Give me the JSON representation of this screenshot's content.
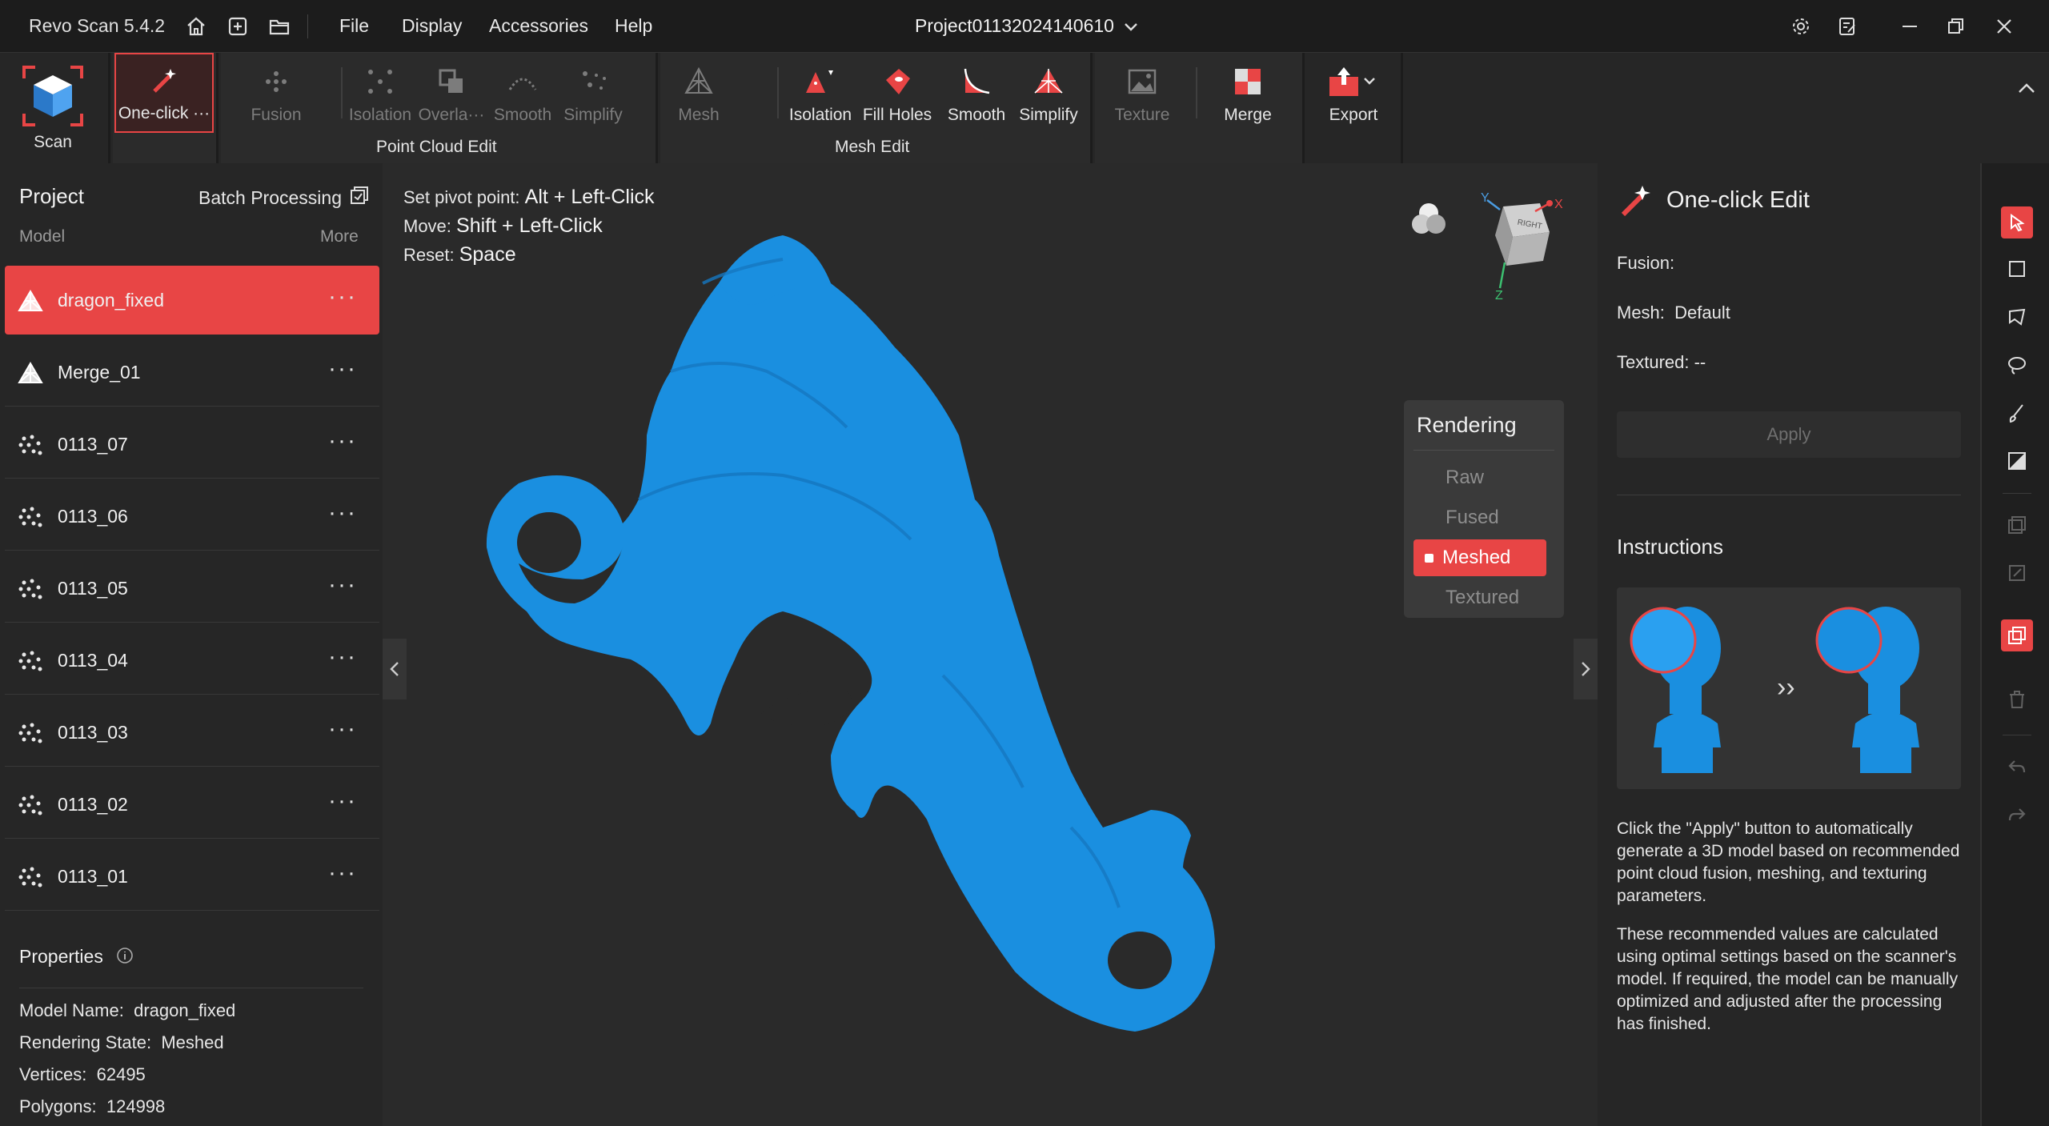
{
  "app": {
    "name": "Revo Scan 5.4.2",
    "project": "Project01132024140610"
  },
  "menu": [
    "File",
    "Display",
    "Accessories",
    "Help"
  ],
  "toolbar": {
    "scan": "Scan",
    "one_click": "One-click ···",
    "fusion": "Fusion",
    "point_cloud": {
      "isolation": "Isolation",
      "overlap": "Overla···",
      "smooth": "Smooth",
      "simplify": "Simplify",
      "label": "Point Cloud Edit"
    },
    "mesh_edit": {
      "mesh": "Mesh",
      "isolation": "Isolation",
      "fill_holes": "Fill Holes",
      "smooth": "Smooth",
      "simplify": "Simplify",
      "label": "Mesh Edit"
    },
    "texture": "Texture",
    "merge": "Merge",
    "export": "Export"
  },
  "left_panel": {
    "title": "Project",
    "batch": "Batch Processing",
    "model_header": "Model",
    "more": "More",
    "models": [
      {
        "name": "dragon_fixed",
        "type": "mesh",
        "selected": true
      },
      {
        "name": "Merge_01",
        "type": "mesh"
      },
      {
        "name": "0113_07",
        "type": "points"
      },
      {
        "name": "0113_06",
        "type": "points"
      },
      {
        "name": "0113_05",
        "type": "points"
      },
      {
        "name": "0113_04",
        "type": "points"
      },
      {
        "name": "0113_03",
        "type": "points"
      },
      {
        "name": "0113_02",
        "type": "points"
      },
      {
        "name": "0113_01",
        "type": "points"
      }
    ],
    "dots": "···",
    "properties_title": "Properties",
    "properties": {
      "model_name_label": "Model Name:",
      "model_name": "dragon_fixed",
      "rendering_label": "Rendering State:",
      "rendering": "Meshed",
      "vertices_label": "Vertices:",
      "vertices": "62495",
      "polygons_label": "Polygons:",
      "polygons": "124998"
    }
  },
  "viewport": {
    "hints": [
      {
        "label": "Set pivot point:",
        "keys": "Alt + Left-Click"
      },
      {
        "label": "Move:",
        "keys": "Shift + Left-Click"
      },
      {
        "label": "Reset:",
        "keys": "Space"
      }
    ],
    "axes": {
      "x": "X",
      "y": "Y",
      "z": "Z",
      "cube_face": "RIGHT"
    },
    "rendering": {
      "title": "Rendering",
      "options": [
        "Raw",
        "Fused",
        "Meshed",
        "Textured"
      ],
      "selected": "Meshed"
    },
    "model_color": "#1a8fe0"
  },
  "right_panel": {
    "title": "One-click Edit",
    "fusion_label": "Fusion:",
    "mesh_label": "Mesh:",
    "mesh_value": "Default",
    "textured_label": "Textured: --",
    "apply": "Apply",
    "instructions_title": "Instructions",
    "instructions_p1": "Click the \"Apply\" button to automatically generate a 3D model based on recommended point cloud fusion, meshing, and texturing parameters.",
    "instructions_p2": "These recommended values are calculated using optimal settings based on the scanner's model. If required, the model can be manually optimized and adjusted after the processing has finished.",
    "arrow": "››"
  },
  "colors": {
    "accent": "#e84545",
    "panel": "#262626",
    "viewport": "#2a2a2a"
  }
}
